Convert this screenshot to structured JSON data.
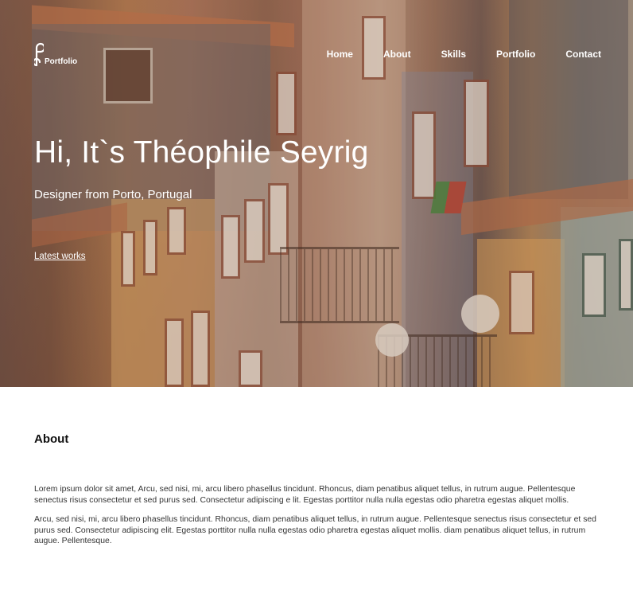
{
  "logo": {
    "icon": "portfolio-logo-icon",
    "text": "Portfolio"
  },
  "nav": {
    "items": [
      {
        "label": "Home"
      },
      {
        "label": "About"
      },
      {
        "label": "Skills"
      },
      {
        "label": "Portfolio"
      },
      {
        "label": "Contact"
      }
    ]
  },
  "hero": {
    "title": "Hi, It`s Théophile Seyrig",
    "subtitle": "Designer from Porto, Portugal",
    "link_label": "Latest works"
  },
  "about": {
    "title": "About",
    "paragraphs": [
      "Lorem ipsum dolor sit amet, Arcu, sed nisi, mi, arcu libero phasellus tincidunt. Rhoncus, diam penatibus aliquet tellus, in rutrum augue. Pellentesque senectus risus consectetur et sed purus sed. Consectetur adipiscing e lit. Egestas porttitor nulla nulla egestas odio pharetra egestas aliquet mollis.",
      "Arcu, sed nisi, mi, arcu libero phasellus tincidunt. Rhoncus, diam penatibus aliquet tellus, in rutrum augue. Pellentesque senectus risus consectetur et sed purus sed. Consectetur adipiscing elit. Egestas porttitor nulla nulla egestas odio pharetra egestas aliquet mollis. diam penatibus aliquet tellus, in rutrum augue. Pellentesque."
    ]
  }
}
